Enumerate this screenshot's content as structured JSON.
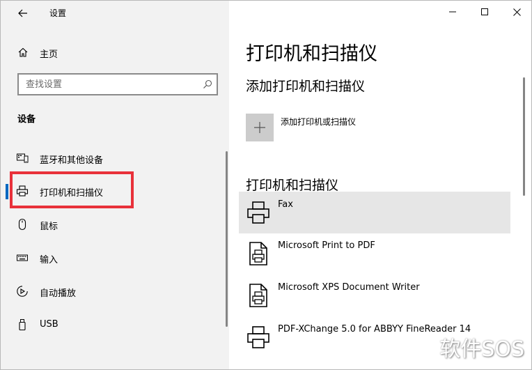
{
  "window": {
    "title": "设置"
  },
  "left": {
    "home_label": "主页",
    "search_placeholder": "查找设置",
    "section_title": "设备",
    "nav_items": [
      {
        "label": "蓝牙和其他设备",
        "icon": "bluetooth-devices-icon"
      },
      {
        "label": "打印机和扫描仪",
        "icon": "printer-icon",
        "active": true
      },
      {
        "label": "鼠标",
        "icon": "mouse-icon"
      },
      {
        "label": "输入",
        "icon": "keyboard-icon"
      },
      {
        "label": "自动播放",
        "icon": "autoplay-icon"
      },
      {
        "label": "USB",
        "icon": "usb-icon"
      }
    ]
  },
  "right": {
    "page_title": "打印机和扫描仪",
    "add_section_title": "添加打印机和扫描仪",
    "add_button_label": "添加打印机或扫描仪",
    "list_title": "打印机和扫描仪",
    "devices": [
      {
        "name": "Fax",
        "icon": "printer-icon",
        "selected": true
      },
      {
        "name": "Microsoft Print to PDF",
        "icon": "document-printer-icon"
      },
      {
        "name": "Microsoft XPS Document Writer",
        "icon": "document-printer-icon"
      },
      {
        "name": "PDF-XChange 5.0 for ABBYY FineReader 14",
        "icon": "printer-icon"
      }
    ]
  },
  "watermark": {
    "text": "软件SOS"
  },
  "colors": {
    "accent": "#0067c0",
    "highlight": "#e8313a",
    "left_bg": "#f2f2f2",
    "selected_bg": "#e6e6e6"
  }
}
